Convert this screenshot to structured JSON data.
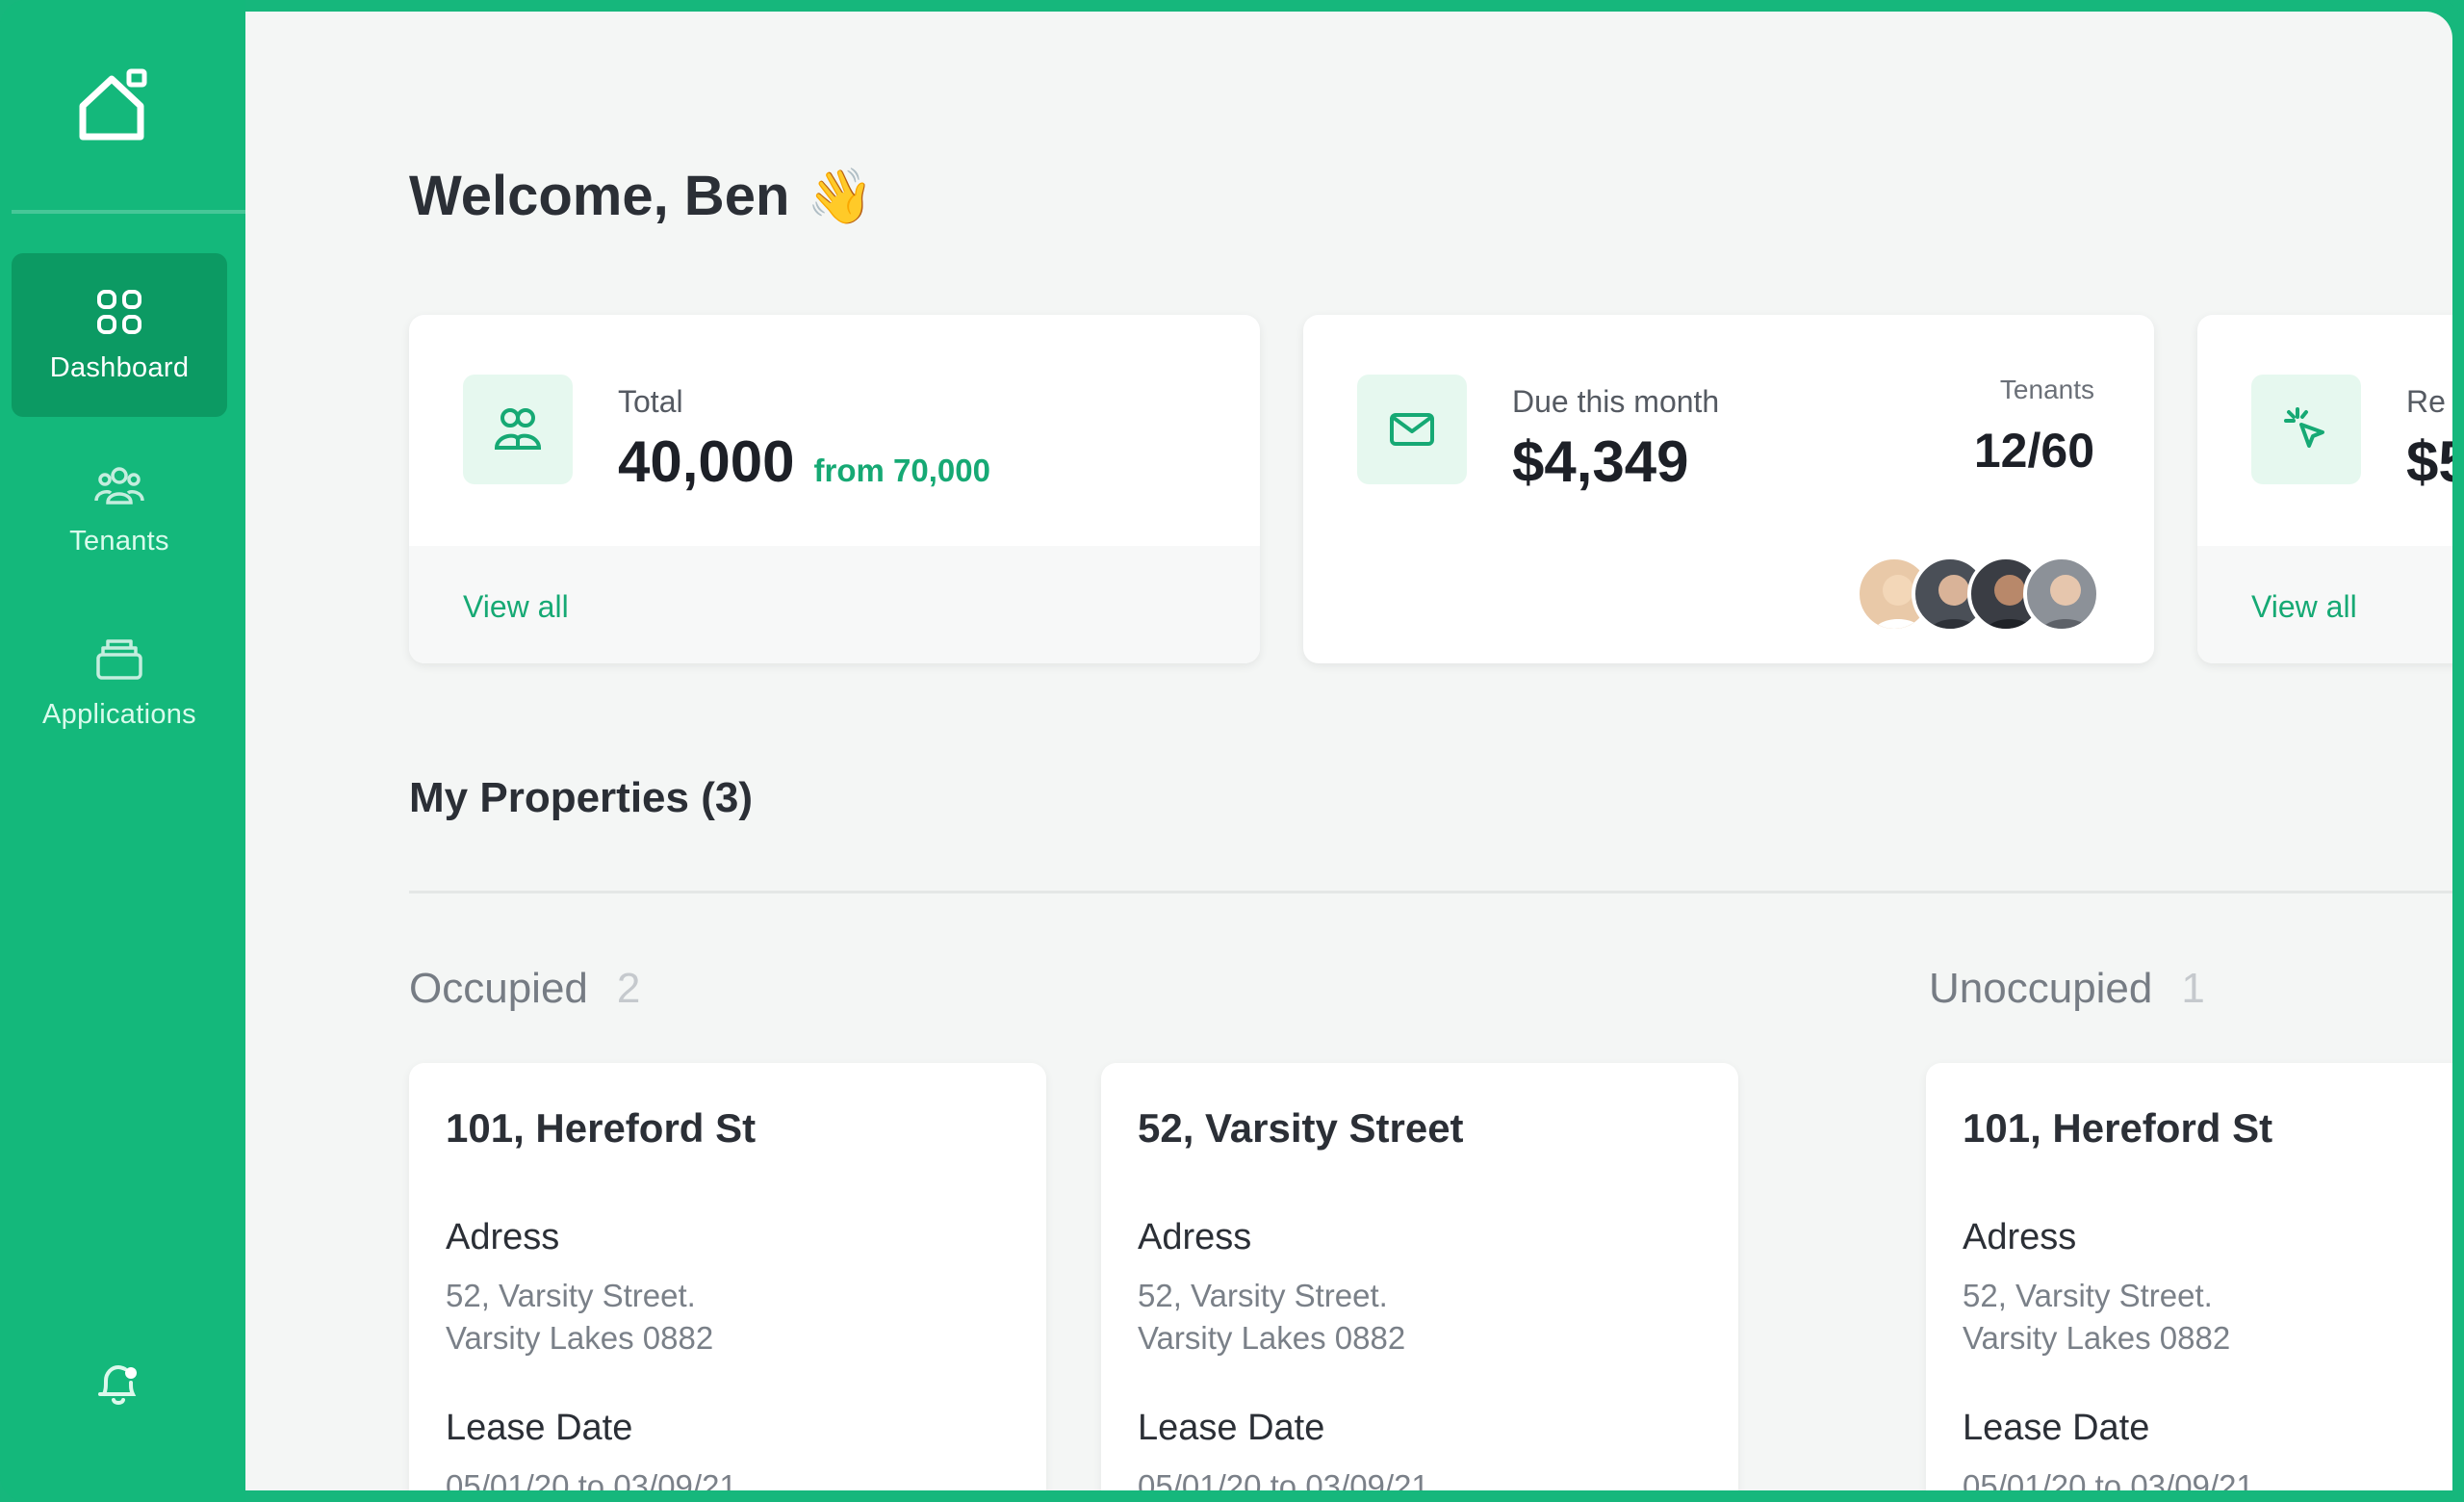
{
  "sidebar": {
    "items": [
      {
        "label": "Dashboard",
        "icon": "grid-icon",
        "active": true
      },
      {
        "label": "Tenants",
        "icon": "people-icon",
        "active": false
      },
      {
        "label": "Applications",
        "icon": "stack-icon",
        "active": false
      }
    ]
  },
  "header": {
    "welcome": "Welcome, Ben",
    "emoji": "👋"
  },
  "cards": {
    "total": {
      "label": "Total",
      "value": "40,000",
      "from": "from 70,000",
      "link": "View all"
    },
    "due": {
      "label": "Due this month",
      "value": "$4,349",
      "right_label": "Tenants",
      "right_value": "12/60"
    },
    "third": {
      "label": "Re",
      "value": "$5",
      "link": "View all"
    }
  },
  "properties": {
    "title": "My Properties (3)",
    "occupied": {
      "label": "Occupied",
      "count": "2"
    },
    "unoccupied": {
      "label": "Unoccupied",
      "count": "1"
    },
    "list": [
      {
        "name": "101, Hereford St",
        "address_label": "Adress",
        "address_line1": "52, Varsity Street.",
        "address_line2": "Varsity Lakes 0882",
        "lease_label": "Lease Date",
        "lease": "05/01/20 to 03/09/21"
      },
      {
        "name": "52, Varsity Street",
        "address_label": "Adress",
        "address_line1": "52, Varsity Street.",
        "address_line2": "Varsity Lakes 0882",
        "lease_label": "Lease Date",
        "lease": "05/01/20 to 03/09/21"
      },
      {
        "name": "101, Hereford St",
        "address_label": "Adress",
        "address_line1": "52, Varsity Street.",
        "address_line2": "Varsity Lakes 0882",
        "lease_label": "Lease Date",
        "lease": "05/01/20 to 03/09/21"
      }
    ]
  },
  "colors": {
    "brand": "#14b87b",
    "accent": "#16a974",
    "active_nav": "#0c9a63"
  }
}
